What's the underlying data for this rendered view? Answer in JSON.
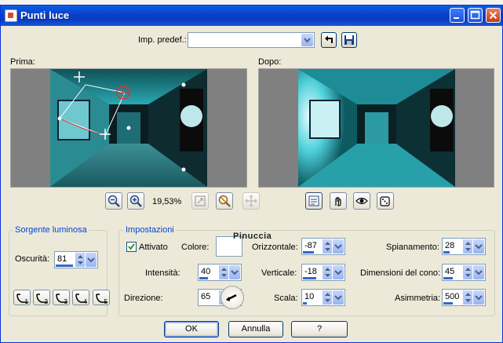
{
  "window": {
    "title": "Punti luce"
  },
  "preset": {
    "label": "Imp. predef.:",
    "value": ""
  },
  "before_label": "Prima:",
  "after_label": "Dopo:",
  "zoom": {
    "value": "19,53%"
  },
  "source_group": {
    "title": "Sorgente luminosa",
    "darkness_label": "Oscurità:",
    "darkness_value": "81"
  },
  "settings_group": {
    "title": "Impostazioni",
    "enabled_label": "Attivato",
    "enabled_checked": true,
    "color_label": "Colore:",
    "intensity_label": "Intensità:",
    "intensity_value": "40",
    "direction_label": "Direzione:",
    "direction_value": "65",
    "horizontal_label": "Orizzontale:",
    "horizontal_value": "-87",
    "vertical_label": "Verticale:",
    "vertical_value": "-18",
    "scale_label": "Scala:",
    "scale_value": "10",
    "flatten_label": "Spianamento:",
    "flatten_value": "28",
    "cone_label": "Dimensioni del cono:",
    "cone_value": "45",
    "asymmetry_label": "Asimmetria:",
    "asymmetry_value": "500"
  },
  "light_shapes": [
    "1",
    "2",
    "3",
    "4",
    "5"
  ],
  "watermark": "Pinuccia",
  "buttons": {
    "ok": "OK",
    "cancel": "Annulla",
    "help": "?"
  },
  "colors": {
    "title_bar": "#0a3bbf",
    "dialog_bg": "#ece9d8",
    "accent": "#0046d5",
    "preview_teal": "#1fa7b3"
  }
}
